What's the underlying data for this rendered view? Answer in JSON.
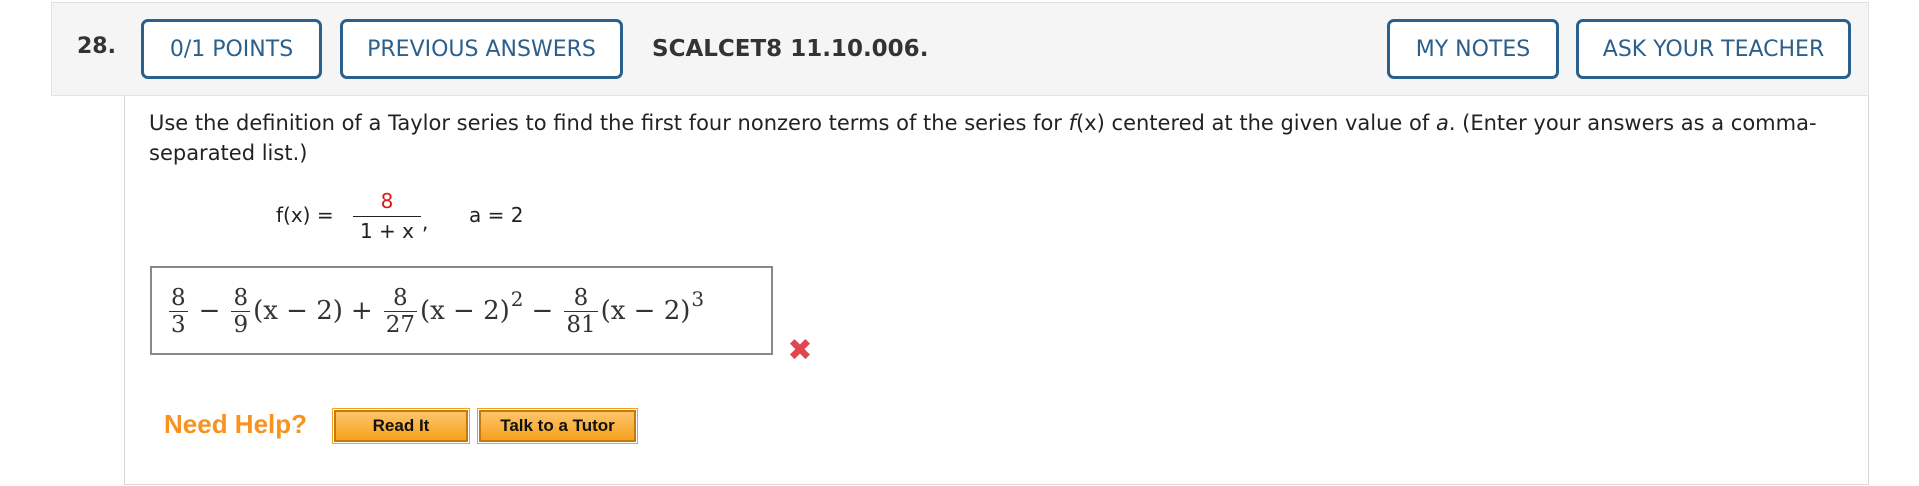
{
  "header": {
    "question_number": "28.",
    "points_button": "0/1 POINTS",
    "previous_answers_button": "PREVIOUS ANSWERS",
    "title": "SCALCET8 11.10.006.",
    "my_notes_button": "MY NOTES",
    "ask_teacher_button": "ASK YOUR TEACHER",
    "accent_color": "#2b5f8c"
  },
  "question": {
    "prompt_part1": "Use the definition of a Taylor series to find the first four nonzero terms of the series for ",
    "prompt_fx": "f",
    "prompt_part2": "(x)",
    "prompt_part3": " centered at the given value of ",
    "prompt_a": "a",
    "prompt_part4": ". (Enter your answers as a comma-separated list.)",
    "function_label": "f(x) =",
    "numerator": "8",
    "denominator": "1 + x",
    "comma": ",",
    "a_value": "a = 2",
    "numerator_color": "#e0161b"
  },
  "answer": {
    "t1_num": "8",
    "t1_den": "3",
    "op1": "−",
    "t2_num": "8",
    "t2_den": "9",
    "t2_factor": "(x − 2)",
    "op2": "+",
    "t3_num": "8",
    "t3_den": "27",
    "t3_factor": "(x − 2)",
    "t3_exp": "2",
    "op3": "−",
    "t4_num": "8",
    "t4_den": "81",
    "t4_factor": "(x − 2)",
    "t4_exp": "3",
    "status_icon": "x-mark-icon",
    "status": "incorrect",
    "status_color": "#e2454f"
  },
  "help": {
    "label": "Need Help?",
    "read_it_button": "Read It",
    "tutor_button": "Talk to a Tutor",
    "label_color": "#f7931e"
  }
}
